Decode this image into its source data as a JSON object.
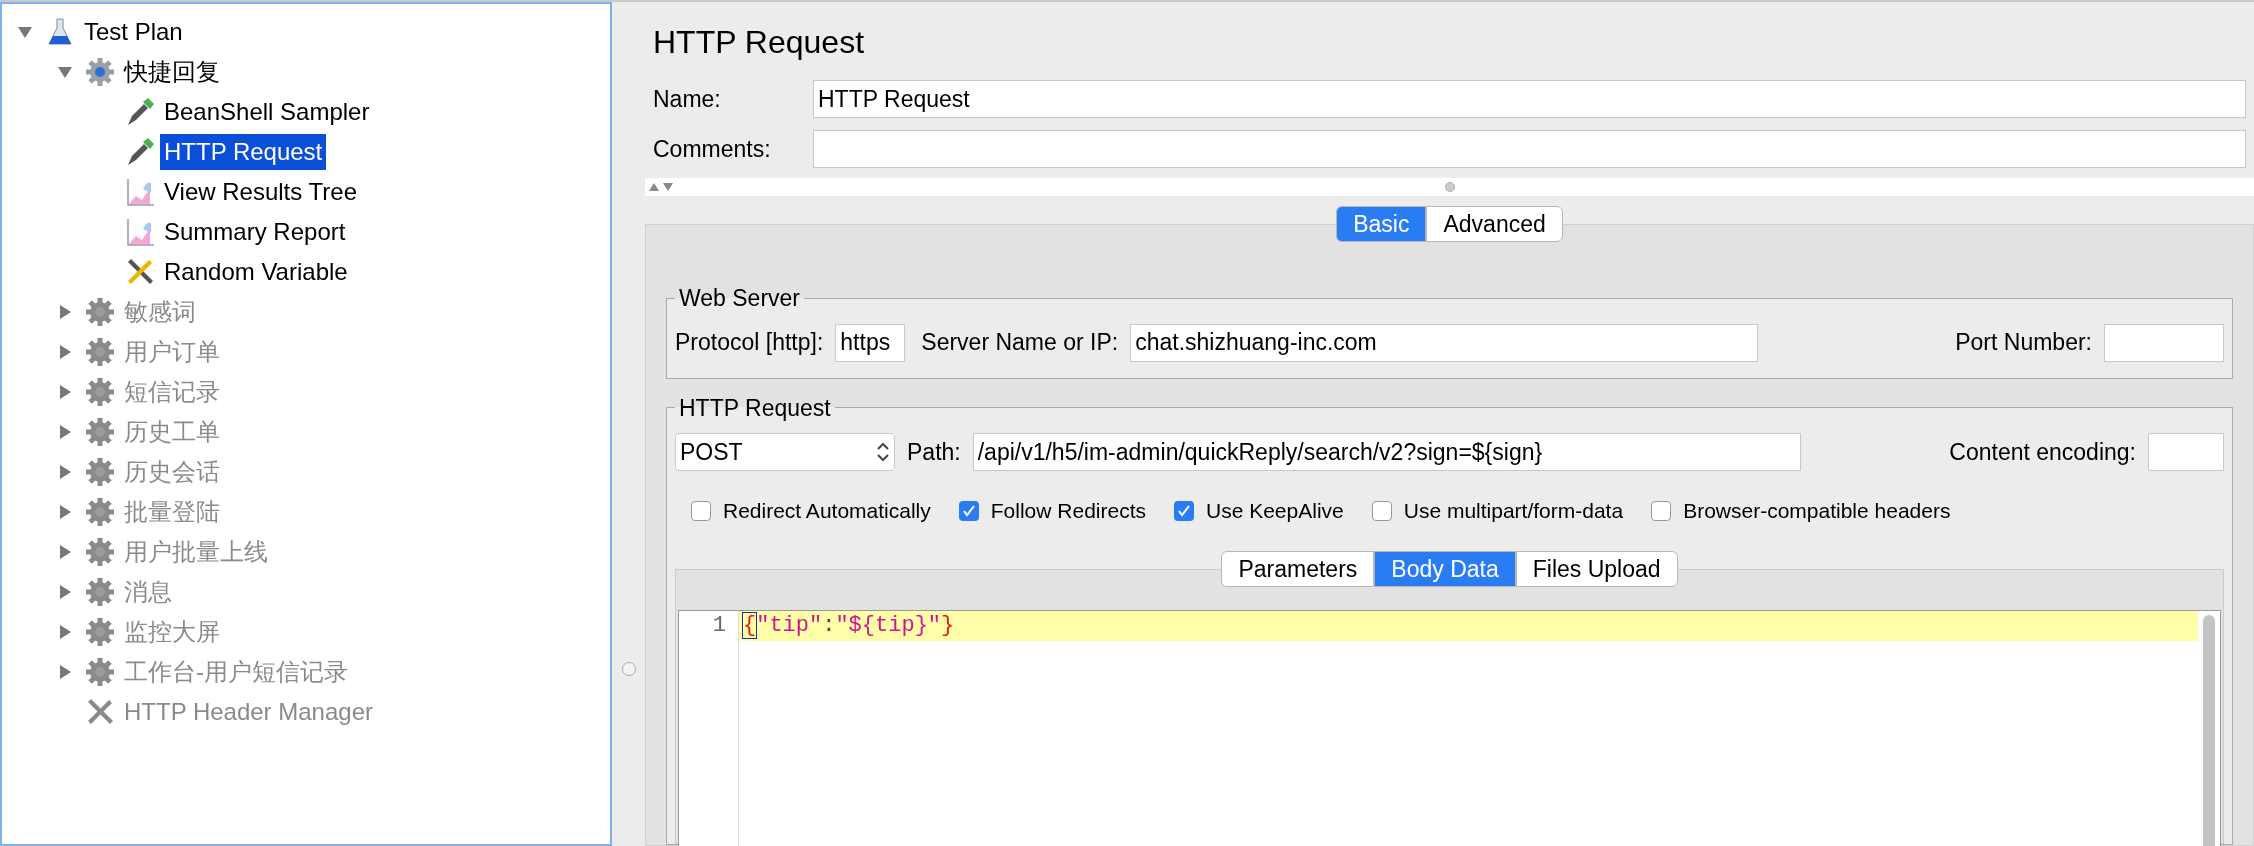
{
  "tree": [
    {
      "label": "Test Plan",
      "kind": "flask",
      "expanded": true,
      "selected": false,
      "disabled": false,
      "children": [
        {
          "label": "快捷回复",
          "kind": "gear",
          "expanded": true,
          "selected": false,
          "disabled": false,
          "children": [
            {
              "label": "BeanShell Sampler",
              "kind": "dropper",
              "selected": false,
              "disabled": false
            },
            {
              "label": "HTTP Request",
              "kind": "dropper",
              "selected": true,
              "disabled": false
            },
            {
              "label": "View Results Tree",
              "kind": "chart",
              "selected": false,
              "disabled": false
            },
            {
              "label": "Summary Report",
              "kind": "chart",
              "selected": false,
              "disabled": false
            },
            {
              "label": "Random Variable",
              "kind": "tools",
              "selected": false,
              "disabled": false
            }
          ]
        },
        {
          "label": "敏感词",
          "kind": "gear",
          "expanded": false,
          "selected": false,
          "disabled": true
        },
        {
          "label": "用户订单",
          "kind": "gear",
          "expanded": false,
          "selected": false,
          "disabled": true
        },
        {
          "label": "短信记录",
          "kind": "gear",
          "expanded": false,
          "selected": false,
          "disabled": true
        },
        {
          "label": "历史工单",
          "kind": "gear",
          "expanded": false,
          "selected": false,
          "disabled": true
        },
        {
          "label": "历史会话",
          "kind": "gear",
          "expanded": false,
          "selected": false,
          "disabled": true
        },
        {
          "label": "批量登陆",
          "kind": "gear",
          "expanded": false,
          "selected": false,
          "disabled": true
        },
        {
          "label": "用户批量上线",
          "kind": "gear",
          "expanded": false,
          "selected": false,
          "disabled": true
        },
        {
          "label": "消息",
          "kind": "gear",
          "expanded": false,
          "selected": false,
          "disabled": true
        },
        {
          "label": "监控大屏",
          "kind": "gear",
          "expanded": false,
          "selected": false,
          "disabled": true
        },
        {
          "label": "工作台-用户短信记录",
          "kind": "gear",
          "expanded": false,
          "selected": false,
          "disabled": true
        },
        {
          "label": "HTTP Header Manager",
          "kind": "tools",
          "selected": false,
          "disabled": true
        }
      ]
    }
  ],
  "editor": {
    "title": "HTTP Request",
    "name": {
      "label": "Name:",
      "value": "HTTP Request"
    },
    "comments": {
      "label": "Comments:"
    },
    "tabs": [
      {
        "label": "Basic",
        "selected": true
      },
      {
        "label": "Advanced",
        "selected": false
      }
    ],
    "web_server": {
      "legend": "Web Server",
      "protocol_label": "Protocol [http]:",
      "protocol": "https",
      "server_label": "Server Name or IP:",
      "server": "chat.shizhuang-inc.com",
      "port_label": "Port Number:"
    },
    "http_request": {
      "legend": "HTTP Request",
      "method": "POST",
      "path_label": "Path:",
      "path": "/api/v1/h5/im-admin/quickReply/search/v2?sign=${sign}",
      "encoding_label": "Content encoding:",
      "options": [
        {
          "label": "Redirect Automatically",
          "checked": false
        },
        {
          "label": "Follow Redirects",
          "checked": true
        },
        {
          "label": "Use KeepAlive",
          "checked": true
        },
        {
          "label": "Use multipart/form-data",
          "checked": false
        },
        {
          "label": "Browser-compatible headers",
          "checked": false
        }
      ],
      "tabs": [
        {
          "label": "Parameters",
          "selected": false
        },
        {
          "label": "Body Data",
          "selected": true
        },
        {
          "label": "Files Upload",
          "selected": false
        }
      ],
      "body": [
        {
          "number": "1",
          "tokens": [
            {
              "text": "{",
              "kind": "brace",
              "matched": true
            },
            {
              "text": "\"tip\"",
              "kind": "string",
              "matched": false
            },
            {
              "text": ":",
              "kind": "punct",
              "matched": false
            },
            {
              "text": "\"${tip}\"",
              "kind": "string",
              "matched": false
            },
            {
              "text": "}",
              "kind": "brace",
              "matched": false
            }
          ]
        }
      ]
    }
  }
}
